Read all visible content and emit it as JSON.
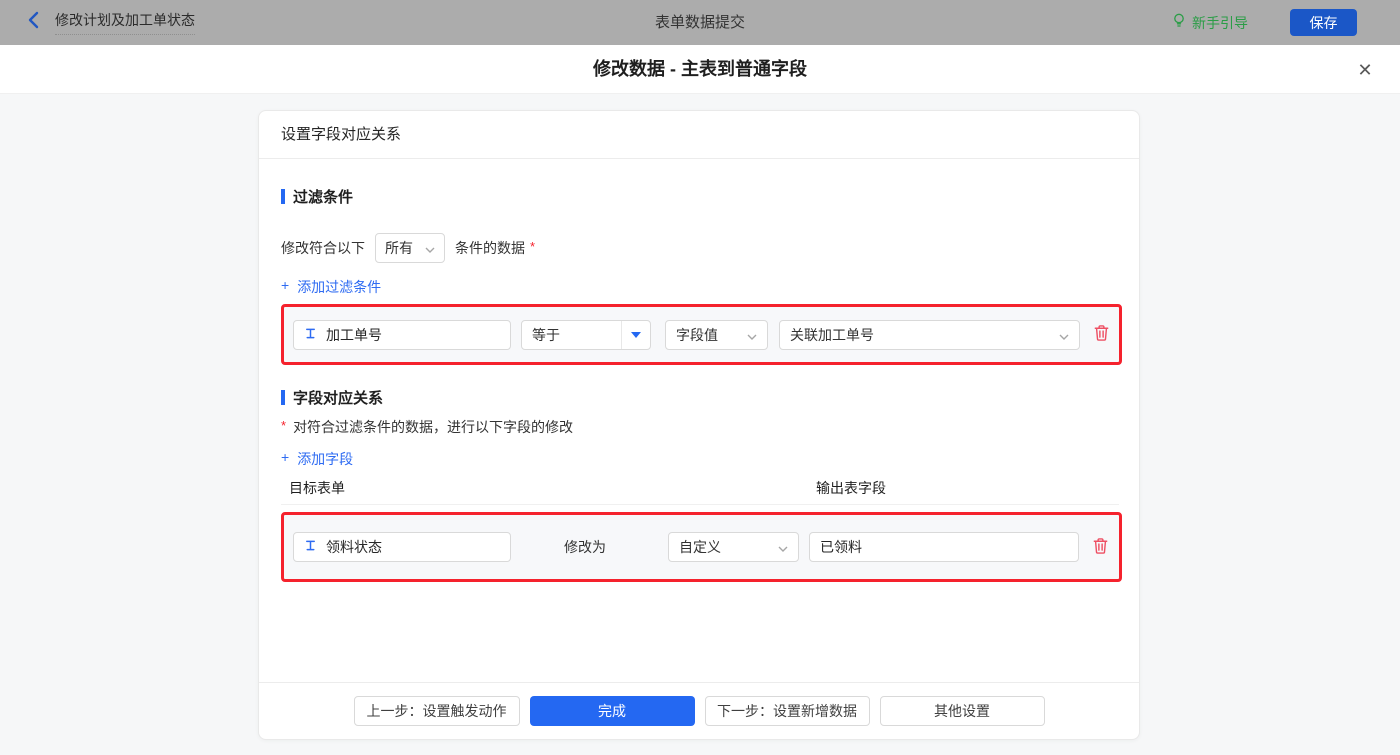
{
  "topbar": {
    "back_label": "修改计划及加工单状态",
    "center_title": "表单数据提交",
    "guide_label": "新手引导",
    "save_label": "保存"
  },
  "dialog": {
    "title": "修改数据 - 主表到普通字段",
    "close_glyph": "✕"
  },
  "panel": {
    "header_title": "设置字段对应关系",
    "filter": {
      "section_title": "过滤条件",
      "match_prefix": "修改符合以下",
      "match_value": "所有",
      "match_suffix": "条件的数据",
      "required_mark": "*",
      "add_plus": "+",
      "add_label": "添加过滤条件",
      "row": {
        "field_name": "加工单号",
        "operator": "等于",
        "value_type": "字段值",
        "value_field": "关联加工单号"
      }
    },
    "mapping": {
      "section_title": "字段对应关系",
      "required_mark": "*",
      "description": "对符合过滤条件的数据，进行以下字段的修改",
      "add_plus": "+",
      "add_label": "添加字段",
      "col_target": "目标表单",
      "col_output": "输出表字段",
      "row": {
        "field_name": "领料状态",
        "action_label": "修改为",
        "value_type": "自定义",
        "value_text": "已领料"
      }
    },
    "footer": {
      "prev_label": "上一步：设置触发动作",
      "done_label": "完成",
      "next_label": "下一步：设置新增数据",
      "other_label": "其他设置"
    }
  },
  "colors": {
    "accent_blue": "#2468f2",
    "highlight_red": "#f5222d",
    "guide_green": "#2a9d46",
    "trash_red": "#ee4f63",
    "topbar_gray": "#acacac"
  }
}
